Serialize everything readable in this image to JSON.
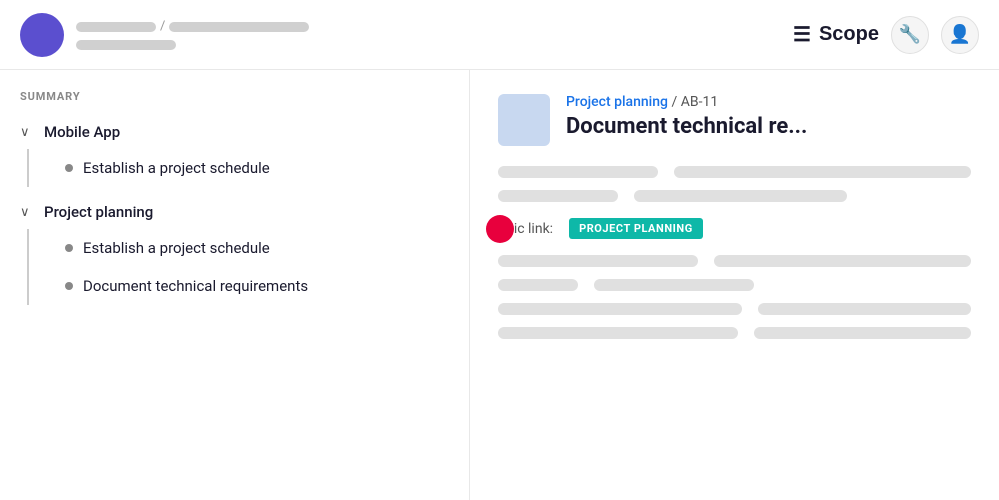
{
  "header": {
    "scope_label": "Scope",
    "breadcrumb_separator": "/",
    "icon_scope": "☰",
    "icon_wrench": "🔧",
    "icon_user": "👤"
  },
  "sidebar": {
    "section_label": "SUMMARY",
    "groups": [
      {
        "id": "mobile-app",
        "label": "Mobile App",
        "expanded": true,
        "children": [
          {
            "id": "establish-1",
            "label": "Establish a project schedule"
          }
        ]
      },
      {
        "id": "project-planning",
        "label": "Project planning",
        "expanded": true,
        "children": [
          {
            "id": "establish-2",
            "label": "Establish a project schedule"
          },
          {
            "id": "doc-tech",
            "label": "Document technical requirements"
          }
        ]
      }
    ]
  },
  "content": {
    "issue_breadcrumb_project": "Project planning",
    "issue_breadcrumb_sep": "/",
    "issue_id": "AB-11",
    "issue_title": "Document technical re...",
    "epic_label": "Epic link:",
    "epic_badge": "PROJECT PLANNING",
    "skeleton_rows": [
      {
        "cols": [
          "w160",
          "full"
        ]
      },
      {
        "cols": [
          "w120",
          "half"
        ]
      },
      {
        "cols": [
          "w200",
          "full"
        ]
      },
      {
        "cols": [
          "w80",
          "w160"
        ]
      },
      {
        "cols": [
          "full",
          "half"
        ]
      },
      {
        "cols": [
          "w240",
          "full"
        ]
      }
    ]
  }
}
